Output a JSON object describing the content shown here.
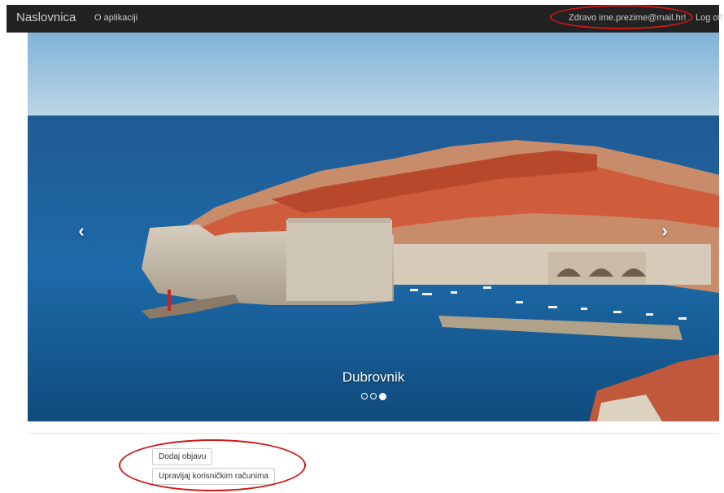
{
  "navbar": {
    "brand": "Naslovnica",
    "about_link": "O aplikaciji",
    "greeting": "Zdravo ime.prezime@mail.hr!",
    "logoff": "Log off"
  },
  "carousel": {
    "caption": "Dubrovnik",
    "prev_glyph": "‹",
    "next_glyph": "›",
    "slide_count": 3,
    "active_slide": 3
  },
  "actions": {
    "add_post": "Dodaj objavu",
    "manage_accounts": "Upravljaj korisničkim računima"
  },
  "colors": {
    "navbar_bg": "#222222",
    "annotation": "#d01818"
  }
}
